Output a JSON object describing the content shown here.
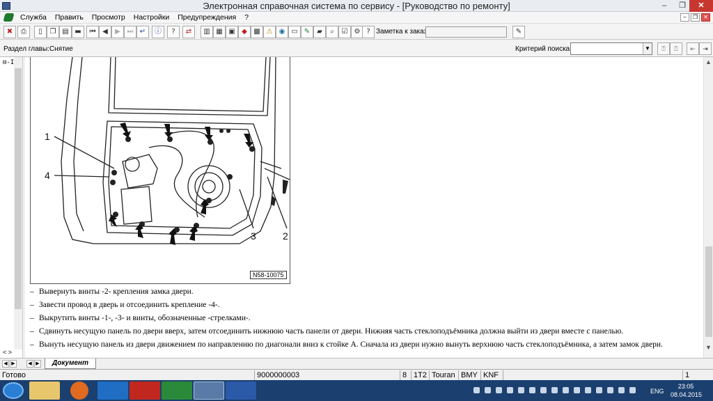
{
  "window": {
    "title": "Электронная справочная система по сервису - [Руководство по ремонту]",
    "controls": {
      "minimize": "–",
      "maximize": "❐",
      "close": "✕"
    }
  },
  "menubar": {
    "items": [
      "Служба",
      "Править",
      "Просмотр",
      "Настройки",
      "Предупреждения",
      "?"
    ],
    "mdi": {
      "minimize": "–",
      "restore": "❐",
      "close": "✕"
    }
  },
  "toolbar": {
    "order_label": "Заметка к заказу:",
    "order_value": ""
  },
  "searchbar": {
    "chapter": "Раздел главы:Снятие",
    "criteria_label": "Критерий поиска:",
    "criteria_value": ""
  },
  "tree": {
    "node": "⊟-I",
    "arrows": "< >"
  },
  "figure": {
    "callouts": [
      "1",
      "4",
      "3",
      "2"
    ],
    "id": "N58-10075"
  },
  "steps": [
    "Вывернуть винты -2- крепления замка двери.",
    "Завести провод в дверь и отсоединить крепление -4-.",
    "Выкрутить винты -1-, -3- и винты, обозначенные -стрелками-.",
    "Сдвинуть несущую панель по двери вверх, затем отсоединить нижнюю часть панели от двери. Нижняя часть стеклоподъёмника должна выйти из двери вместе с панелью.",
    "Вынуть несущую панель из двери движением по направлению по диагонали вниз к стойке А. Сначала из двери нужно вынуть верхнюю часть стеклоподъёмника, а затем замок двери."
  ],
  "step_dash": "–",
  "tabs": {
    "document": "Документ"
  },
  "status": {
    "ready": "Готово",
    "code": "9000000003",
    "num": "8",
    "model_code": "1T2",
    "model": "Touran",
    "engine": "BMY",
    "gearbox": "KNF",
    "page": "1"
  },
  "taskbar": {
    "language": "ENG",
    "time": "23:05",
    "date": "08.04.2015"
  },
  "colors": {
    "title_bg": "#e9edf2",
    "close_red": "#c7372f",
    "taskbar": "#1b3f6e"
  }
}
